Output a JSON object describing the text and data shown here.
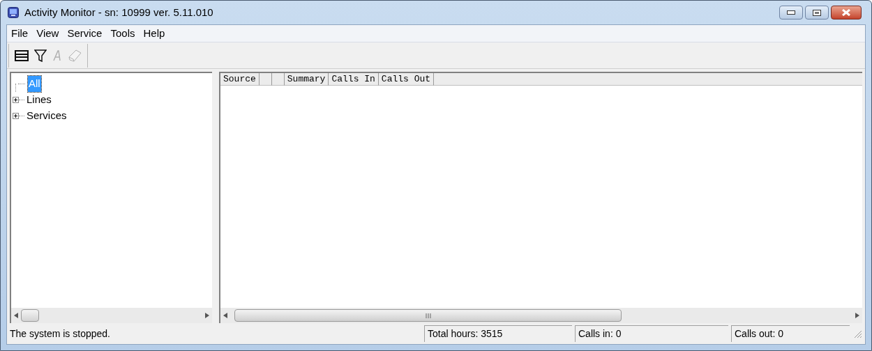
{
  "window": {
    "title": "Activity Monitor - sn: 10999 ver. 5.11.010"
  },
  "menu": [
    "File",
    "View",
    "Service",
    "Tools",
    "Help"
  ],
  "toolbar": [
    {
      "kind": "list",
      "disabled": false
    },
    {
      "kind": "filter",
      "disabled": false
    },
    {
      "kind": "font",
      "disabled": true
    },
    {
      "kind": "eraser",
      "disabled": true
    }
  ],
  "tree": [
    {
      "label": "All",
      "selected": true
    },
    {
      "label": "Lines",
      "selected": false,
      "expanded": false
    },
    {
      "label": "Services",
      "selected": false,
      "expanded": false
    }
  ],
  "table": {
    "columns": [
      "Source",
      "Summary",
      "Calls In",
      "Calls Out"
    ]
  },
  "status_bar": {
    "message": "The system is stopped.",
    "panes": [
      "Total hours: 3515",
      "Calls in: 0",
      "Calls out: 0"
    ]
  }
}
